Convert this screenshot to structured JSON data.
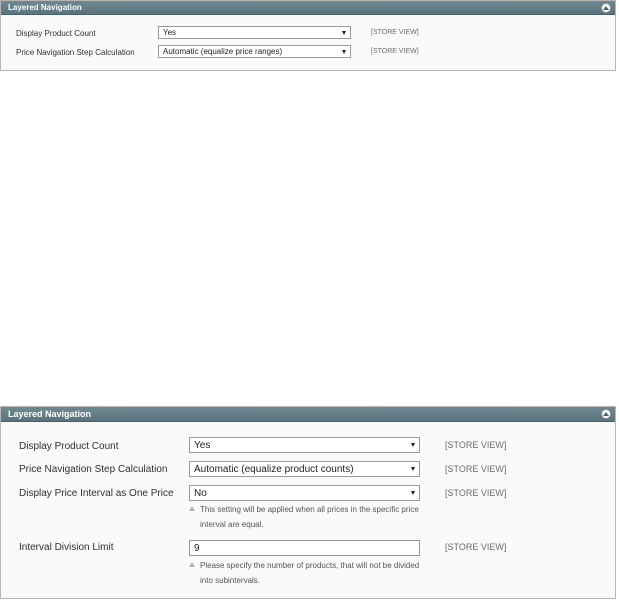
{
  "panel_top": {
    "title": "Layered Navigation",
    "rows": [
      {
        "label": "Display Product Count",
        "value": "Yes",
        "scope": "[STORE VIEW]"
      },
      {
        "label": "Price Navigation Step Calculation",
        "value": "Automatic (equalize price ranges)",
        "scope": "[STORE VIEW]"
      }
    ]
  },
  "panel_bottom": {
    "title": "Layered Navigation",
    "rows": [
      {
        "label": "Display Product Count",
        "value": "Yes",
        "scope": "[STORE VIEW]"
      },
      {
        "label": "Price Navigation Step Calculation",
        "value": "Automatic (equalize product counts)",
        "scope": "[STORE VIEW]"
      },
      {
        "label": "Display Price Interval as One Price",
        "value": "No",
        "scope": "[STORE VIEW]",
        "note": "This setting will be applied when all prices in the specific price interval are equal."
      },
      {
        "label": "Interval Division Limit",
        "value": "9",
        "scope": "[STORE VIEW]",
        "note": "Please specify the number of products, that will not be divided into subintervals."
      }
    ]
  },
  "colors": {
    "header_bg": "#647d86",
    "panel_bg": "#fafafa",
    "border": "#b6b6b6"
  },
  "icons": {
    "collapse": "collapse-up-icon",
    "dropdown": "chevron-down-icon",
    "note": "note-arrow-icon"
  }
}
